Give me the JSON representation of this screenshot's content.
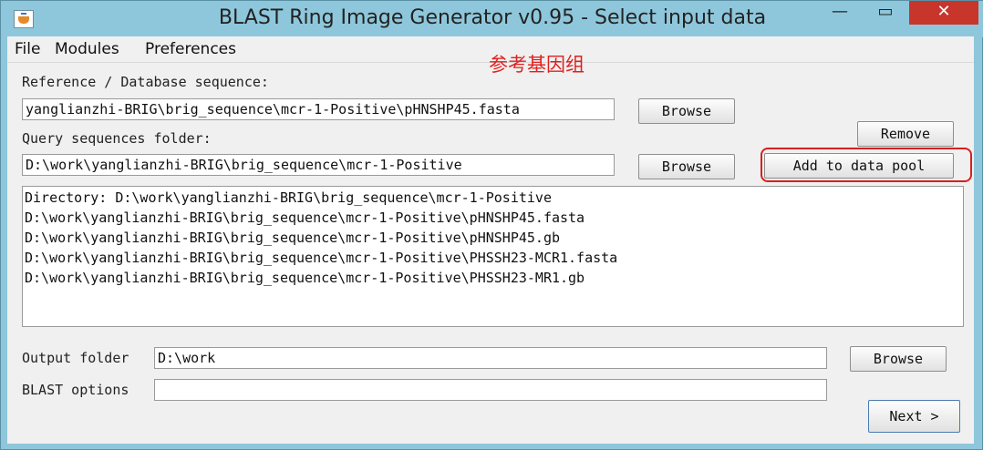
{
  "window": {
    "title": "BLAST Ring Image Generator v0.95 - Select input data",
    "minimize_glyph": "—",
    "maximize_glyph": "▭",
    "close_glyph": "✕",
    "icon": "java-cup-icon"
  },
  "menu": [
    "File",
    "Modules",
    "Preferences"
  ],
  "annotation": "参考基因组",
  "reference": {
    "label": "Reference / Database sequence:",
    "value": "yanglianzhi-BRIG\\brig_sequence\\mcr-1-Positive\\pHNSHP45.fasta",
    "browse_label": "Browse"
  },
  "query": {
    "label": "Query sequences folder:",
    "value": "D:\\work\\yanglianzhi-BRIG\\brig_sequence\\mcr-1-Positive",
    "browse_label": "Browse",
    "remove_label": "Remove",
    "add_label": "Add to data pool"
  },
  "data_pool": [
    "Directory: D:\\work\\yanglianzhi-BRIG\\brig_sequence\\mcr-1-Positive",
    "D:\\work\\yanglianzhi-BRIG\\brig_sequence\\mcr-1-Positive\\pHNSHP45.fasta",
    "D:\\work\\yanglianzhi-BRIG\\brig_sequence\\mcr-1-Positive\\pHNSHP45.gb",
    "D:\\work\\yanglianzhi-BRIG\\brig_sequence\\mcr-1-Positive\\PHSSH23-MCR1.fasta",
    "D:\\work\\yanglianzhi-BRIG\\brig_sequence\\mcr-1-Positive\\PHSSH23-MR1.gb"
  ],
  "output": {
    "label": "Output folder",
    "value": "D:\\work",
    "browse_label": "Browse"
  },
  "blast": {
    "label": "BLAST options",
    "value": ""
  },
  "next_label": "Next >",
  "colors": {
    "titlebar": "#8ec7db",
    "close": "#c7352b",
    "highlight": "#d62020",
    "annotation": "#e02020"
  }
}
